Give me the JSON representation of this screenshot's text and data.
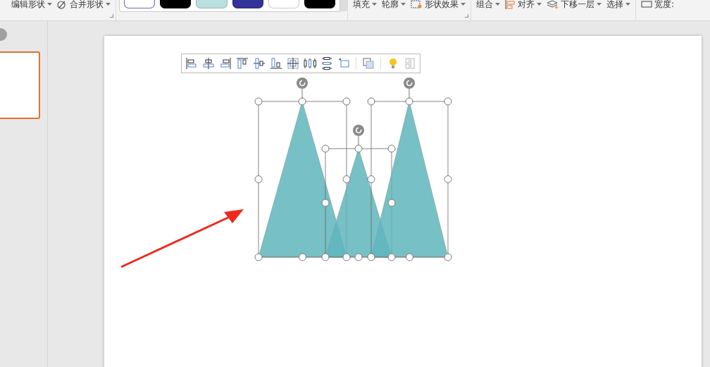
{
  "ribbon": {
    "groups": [
      {
        "kind": "buttons",
        "items": [
          {
            "label": "编辑形状",
            "dropdown": true
          },
          {
            "label": "合并形状",
            "dropdown": true
          }
        ]
      },
      {
        "kind": "gallery",
        "swatches": [
          {
            "color": "#ffffff"
          },
          {
            "color": "#000000"
          },
          {
            "color": "#b9dfe0"
          },
          {
            "color": "#333399"
          },
          {
            "color": "#ffffff"
          },
          {
            "color": "#000000"
          }
        ]
      },
      {
        "kind": "buttons",
        "items": [
          {
            "label": "填充",
            "dropdown": true
          },
          {
            "label": "轮廓",
            "dropdown": true
          },
          {
            "label": "形状效果",
            "dropdown": true
          }
        ]
      },
      {
        "kind": "buttons",
        "items": [
          {
            "label": "组合",
            "dropdown": true
          },
          {
            "label": "对齐",
            "dropdown": true
          },
          {
            "label": "下移一层",
            "dropdown": true
          },
          {
            "label": "选择",
            "dropdown": true
          }
        ]
      },
      {
        "kind": "buttons",
        "items": [
          {
            "label": "宽度:",
            "dropdown": false
          }
        ]
      }
    ]
  },
  "slides": [
    {
      "selected": true
    }
  ],
  "shapes": [
    {
      "kind": "triangle",
      "selected": true
    },
    {
      "kind": "triangle",
      "selected": true
    },
    {
      "kind": "triangle",
      "selected": true
    }
  ]
}
